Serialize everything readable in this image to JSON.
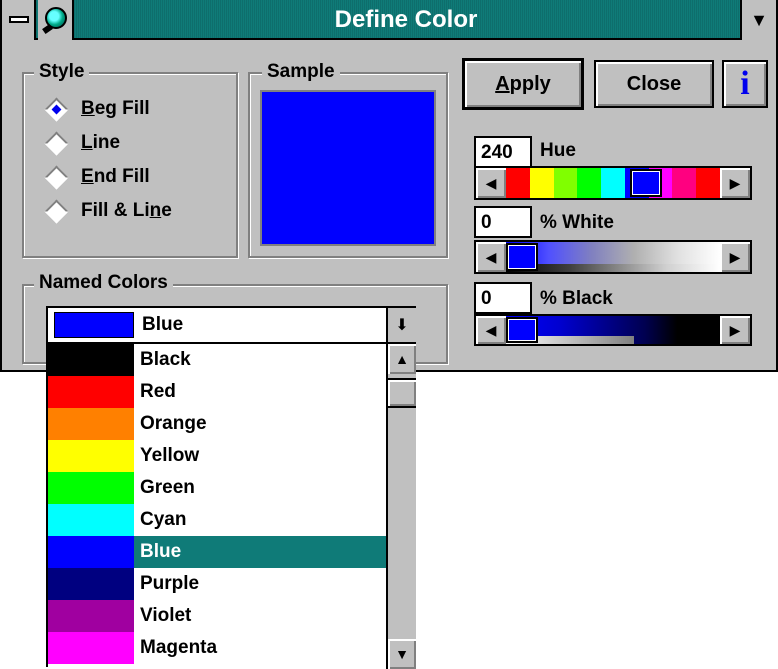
{
  "window": {
    "title": "Define Color",
    "max_glyph": "▼"
  },
  "style_group": {
    "label": "Style",
    "options": [
      {
        "pre": "",
        "acc": "B",
        "post": "eg Fill",
        "checked": true
      },
      {
        "pre": "",
        "acc": "L",
        "post": "ine",
        "checked": false
      },
      {
        "pre": "",
        "acc": "E",
        "post": "nd Fill",
        "checked": false
      },
      {
        "pre": "Fill & Li",
        "acc": "n",
        "post": "e",
        "checked": false
      }
    ]
  },
  "sample_group": {
    "label": "Sample",
    "color": "#0000ff"
  },
  "buttons": {
    "apply_acc": "A",
    "apply_rest": "pply",
    "close": "Close",
    "info_glyph": "i"
  },
  "hue": {
    "value": "240",
    "label": "Hue",
    "fraction": 0.667
  },
  "white": {
    "value": "0",
    "label": "% White",
    "fraction": 0.0
  },
  "black": {
    "value": "0",
    "label": "% Black",
    "fraction": 0.0
  },
  "named_colors": {
    "label": "Named Colors",
    "selected": "Blue",
    "selected_color": "#0000ff",
    "items": [
      {
        "name": "Black",
        "color": "#000000"
      },
      {
        "name": "Red",
        "color": "#ff0000"
      },
      {
        "name": "Orange",
        "color": "#ff8000"
      },
      {
        "name": "Yellow",
        "color": "#ffff00"
      },
      {
        "name": "Green",
        "color": "#00ff00"
      },
      {
        "name": "Cyan",
        "color": "#00ffff"
      },
      {
        "name": "Blue",
        "color": "#0000ff",
        "selected": true
      },
      {
        "name": "Purple",
        "color": "#000080"
      },
      {
        "name": "Violet",
        "color": "#a000a0"
      },
      {
        "name": "Magenta",
        "color": "#ff00ff"
      }
    ]
  },
  "icons": {
    "up": "▲",
    "down": "▼",
    "left": "◀",
    "right": "▶",
    "combo_down": "⬇"
  }
}
